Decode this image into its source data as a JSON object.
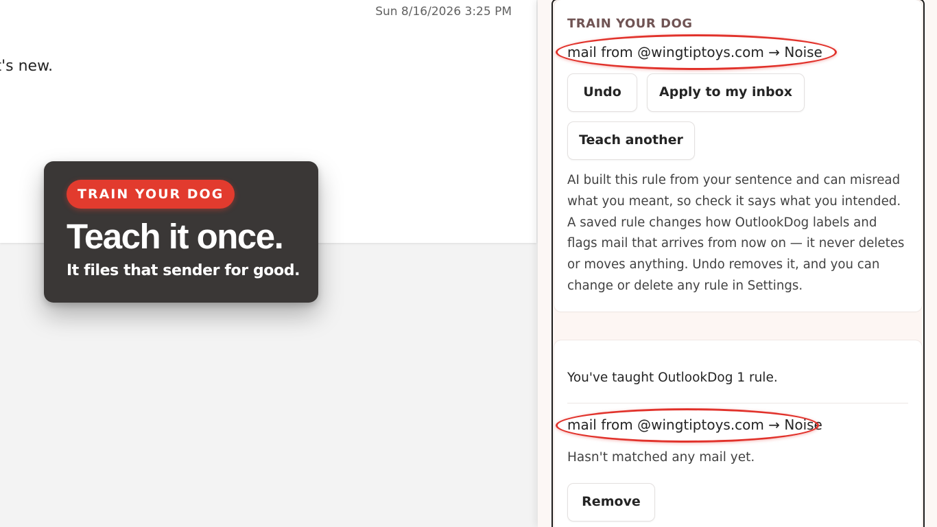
{
  "email": {
    "date": "Sun 8/16/2026 3:25 PM",
    "body_fragment": "at's new."
  },
  "callout": {
    "tag": "TRAIN YOUR DOG",
    "title": "Teach it once.",
    "subtitle": "It files that sender for good."
  },
  "panel": {
    "section_title": "TRAIN YOUR DOG",
    "new_rule": "mail from @wingtiptoys.com → Noise",
    "buttons": {
      "undo": "Undo",
      "apply": "Apply to my inbox",
      "teach_another": "Teach another"
    },
    "disclaimer": "AI built this rule from your sentence and can misread what you meant, so check it says what you intended. A saved rule changes how OutlookDog labels and flags mail that arrives from now on — it never deletes or moves anything. Undo removes it, and you can change or delete any rule in Settings."
  },
  "rules": {
    "summary": "You've taught OutlookDog 1 rule.",
    "items": [
      {
        "text": "mail from @wingtiptoys.com → Noise",
        "status": "Hasn't matched any mail yet.",
        "remove_label": "Remove"
      }
    ]
  },
  "colors": {
    "accent": "#e23b2e",
    "highlight_ring": "#e1322b",
    "callout_bg": "#3a3736",
    "eyebrow": "#705454"
  }
}
